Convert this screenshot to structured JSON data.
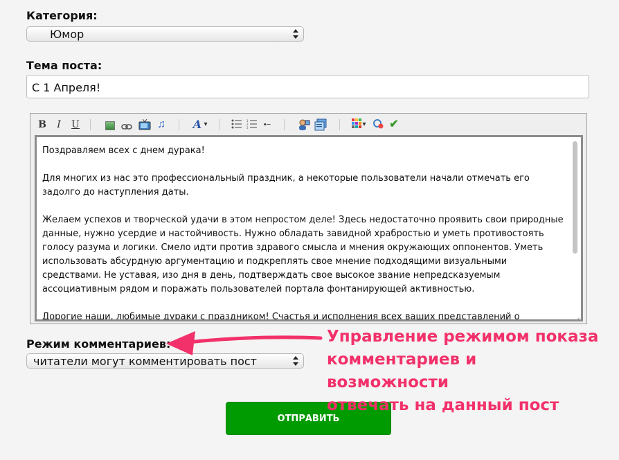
{
  "category": {
    "label": "Категория:",
    "selected": "Юмор"
  },
  "post_title": {
    "label": "Тема поста:",
    "value": "С 1 Апреля!"
  },
  "toolbar": {
    "icons": {
      "bold": "B",
      "italic": "I",
      "underline": "U",
      "image": "image-icon",
      "link": "link-icon",
      "video": "tv-icon",
      "music": "♫",
      "font": "A",
      "font_caret": "▾",
      "ul": "bulleted-list-icon",
      "ol": "numbered-list-icon",
      "hr": "•−",
      "person": "person-icon",
      "quote": "quote-icon",
      "color": "color-grid-icon",
      "color_caret": "▾",
      "smile": "emoticon-icon",
      "check": "✔"
    }
  },
  "editor": {
    "paragraphs": [
      "Поздравляем всех с днем дурака!",
      "Для многих из нас это профессиональный праздник, а некоторые пользователи начали отмечать  его задолго до наступления даты.",
      "Желаем успехов и творческой удачи в этом непростом деле! Здесь недостаточно проявить свои природные данные, нужно усердие и настойчивость. Нужно обладать завидной храбростью и уметь противостоять голосу разума и логики. Смело идти против здравого смысла и мнения окружающих оппонентов. Уметь использовать абсурдную аргументацию и подкреплять свое мнение подходящими визуальными средствами. Не уставая, изо дня в день, подтверждать свое высокое звание непредсказуемым ассоциативным рядом и поражать пользователей портала фонтанирующей активностью.",
      "Дорогие наши, любимые дураки с праздником! Счастья и исполнения всех ваших представлений о реальности в"
    ]
  },
  "comments_mode": {
    "label": "Режим комментариев:",
    "selected": "читатели могут комментировать пост"
  },
  "submit_label": "ОТПРАВИТЬ",
  "annotation": {
    "lines": [
      "Управление режимом показа",
      "комментариев и возможности",
      "отвечать на данный пост"
    ],
    "color": "#f2316a"
  },
  "colors": {
    "submit_bg": "#009b00",
    "annotation": "#f2316a"
  }
}
